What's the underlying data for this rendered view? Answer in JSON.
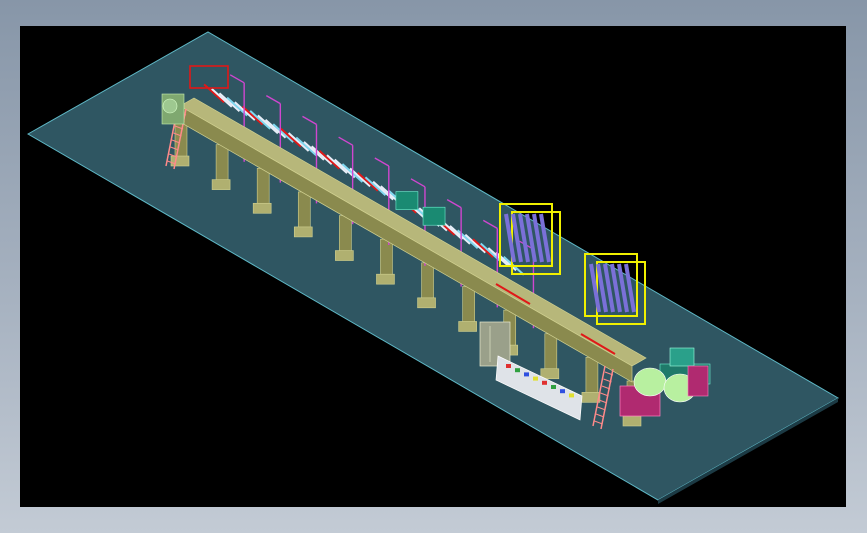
{
  "app": {
    "frame_color": "#9aa6b6",
    "viewport_background": "#000000"
  },
  "drawing": {
    "subject": "isometric-production-line-cad-model",
    "colors": {
      "floor": "#2f5662",
      "floor_edge": "#5fb8c6",
      "beam": "#8a8a4e",
      "beam_edge": "#d0d090",
      "frame_magenta": "#d046d0",
      "frame_yellow": "#f0f000",
      "frame_red": "#e01818",
      "roller_white": "#e8eef8",
      "roller_blue": "#7a70d8",
      "ladder": "#ff8a8a",
      "cabinet": "#9aa08a",
      "control_panel": "#dfe3e8",
      "winder_green": "#b8f0a0",
      "winder_teal": "#2aa08a",
      "base_magenta": "#b02a70"
    }
  }
}
